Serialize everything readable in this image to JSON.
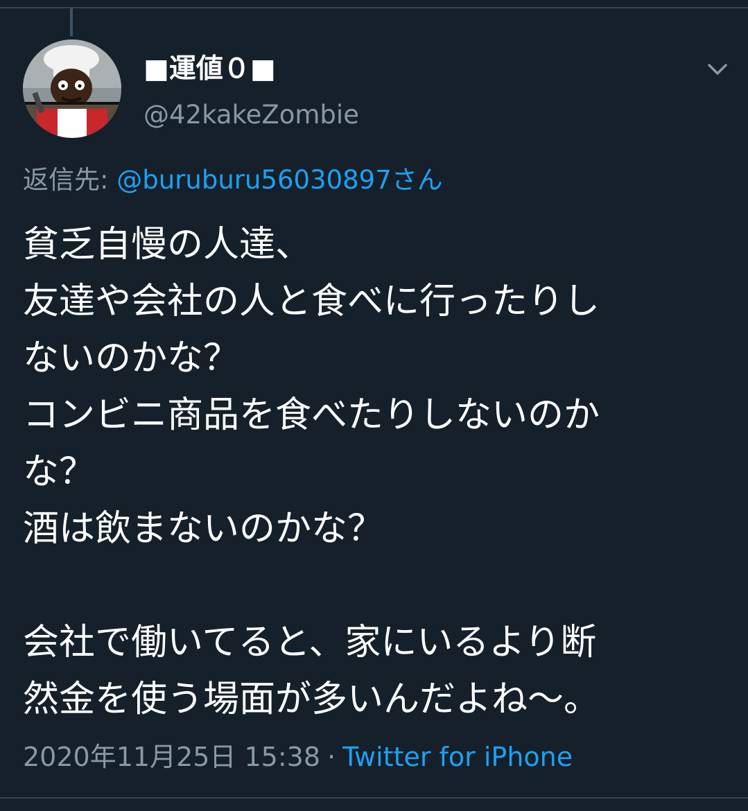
{
  "tweet": {
    "author": {
      "display_name": "■運値０■",
      "handle": "@42kakeZombie",
      "avatar_icon": "avatar-icon"
    },
    "reply_to": {
      "prefix": "返信先: ",
      "user": "@buruburu56030897さん"
    },
    "text_lines": [
      "貧乏自慢の人達、",
      "友達や会社の人と食べに行ったりし",
      "ないのかな？",
      "コンビニ商品を食べたりしないのか",
      "な？",
      "酒は飲まないのかな？",
      "",
      "会社で働いてると、家にいるより断",
      "然金を使う場面が多いんだよね〜。"
    ],
    "timestamp": "2020年11月25日 15:38",
    "separator": "·",
    "source": "Twitter for iPhone"
  },
  "icons": {
    "more": "chevron-down-icon"
  },
  "colors": {
    "background": "#15202b",
    "text": "#ffffff",
    "secondary_text": "#8899a6",
    "link": "#1da1f2",
    "border": "#38444d"
  }
}
